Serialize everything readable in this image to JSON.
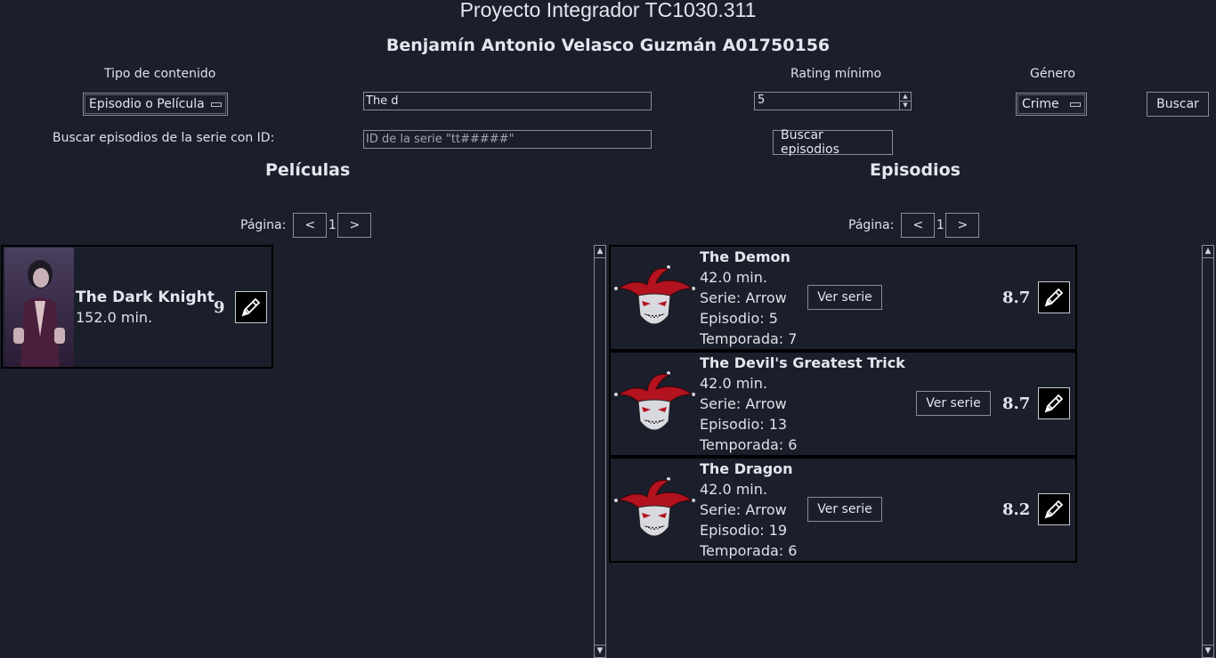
{
  "header": {
    "title": "Proyecto Integrador TC1030.311",
    "subtitle": "Benjamín Antonio Velasco Guzmán A01750156"
  },
  "filters": {
    "tipo_label": "Tipo de contenido",
    "tipo_value": "Episodio o Película",
    "search_value": "The d",
    "rating_label": "Rating mínimo",
    "rating_value": "5",
    "genero_label": "Género",
    "genero_value": "Crime",
    "buscar_label": "Buscar",
    "serie_label": "Buscar episodios de la serie con ID:",
    "serie_placeholder": "ID de la serie \"tt#####\"",
    "buscar_episodios_label": "Buscar episodios"
  },
  "peliculas": {
    "heading": "Películas",
    "pagina_label": "Página:",
    "prev": "<",
    "page": "1",
    "next": ">",
    "items": [
      {
        "title": "The Dark Knight",
        "duration": "152.0 min.",
        "rating": "9"
      }
    ]
  },
  "episodios": {
    "heading": "Episodios",
    "pagina_label": "Página:",
    "prev": "<",
    "page": "1",
    "next": ">",
    "ver_serie_label": "Ver serie",
    "items": [
      {
        "title": "The Demon",
        "duration": "42.0 min.",
        "serie": "Serie: Arrow",
        "episodio": "Episodio: 5",
        "temporada": "Temporada: 7",
        "rating": "8.7"
      },
      {
        "title": "The Devil's Greatest Trick",
        "duration": "42.0 min.",
        "serie": "Serie: Arrow",
        "episodio": "Episodio: 13",
        "temporada": "Temporada: 6",
        "rating": "8.7"
      },
      {
        "title": "The Dragon",
        "duration": "42.0 min.",
        "serie": "Serie: Arrow",
        "episodio": "Episodio: 19",
        "temporada": "Temporada: 6",
        "rating": "8.2"
      }
    ]
  },
  "colors": {
    "background": "#1b1e2b",
    "text": "#dfe1e8",
    "jester_red": "#b3121f"
  },
  "icons": {
    "edit": "pencil-icon",
    "episode_thumb": "jester-icon",
    "movie_thumb": "poster-photo"
  }
}
